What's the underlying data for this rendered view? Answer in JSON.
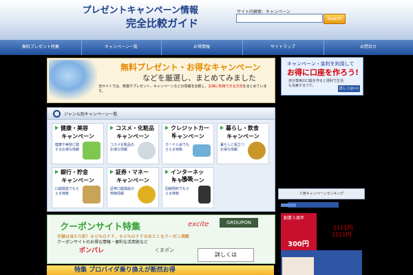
{
  "header": {
    "title_line1": "プレゼントキャンペーン情報",
    "title_line2": "完全比較ガイド",
    "search_label": "サイト内検索：キャンペーン",
    "search_placeholder": "",
    "search_button": "Search"
  },
  "nav": {
    "items": [
      {
        "label": "無料プレゼント特集"
      },
      {
        "label": "キャンペーン一覧"
      },
      {
        "label": "お得情報"
      },
      {
        "label": "サイトマップ"
      },
      {
        "label": "お問合せ"
      }
    ]
  },
  "banner": {
    "headline": "無料プレゼント・お得なキャンペーン",
    "subhead": "などを厳選し、まとめてみました",
    "body_prefix": "当サイトでは、懸賞やプレゼント、キャンペーンなどの情報を比較し、",
    "body_highlight": "お得に利用できる方法",
    "body_suffix": "をまとめています。"
  },
  "side_ad": {
    "line1": "キャンペーン・金利を利用して",
    "line2": "お得に口座を作ろう!",
    "line3": "自分専用の口座を作ると便利で生活も充実するワケ。",
    "button": "詳しくは>>"
  },
  "categories": {
    "heading": "ジャンル別キャンペーン一覧",
    "cards": [
      {
        "title": "健康・美容",
        "title2": "キャンペーン",
        "desc": "健康や美容に関するお得な情報",
        "color": "#7ec850"
      },
      {
        "title": "コスメ・化粧品",
        "title2": "キャンペーン",
        "desc": "コスメ化粧品のお得な情報",
        "color": "#d0d8e0"
      },
      {
        "title": "クレジットカード",
        "title2": "キャンペーン",
        "desc": "カード入会でもらえる特典",
        "color": "#6fb0d8"
      },
      {
        "title": "暮らし・飲食",
        "title2": "キャンペーン",
        "desc": "暮らしに役立つお得な情報",
        "color": "#c9962a"
      },
      {
        "title": "銀行・貯金",
        "title2": "キャンペーン",
        "desc": "口座開設でもらえる特典",
        "color": "#c9a357"
      },
      {
        "title": "証券・マネー",
        "title2": "キャンペーン",
        "desc": "証券口座開設の特典情報",
        "color": "#e0b020"
      },
      {
        "title": "インターネット・携帯",
        "title2": "キャンペーン",
        "desc": "回線契約でもらえる特典",
        "color": "#333333"
      }
    ]
  },
  "coupon": {
    "heading": "クーポンサイト特集",
    "excite": "excite",
    "groupon": "GROUPON",
    "line1": "半額は当たり前！８０％ＯＦＦ、９０％ＯＦＦのおとくなクーポン満載",
    "line2": "クーポンサイトのお得な情報・便利な活用術など",
    "logo1": "ポンパレ",
    "logo2": "くまポン",
    "button": "詳しくは"
  },
  "bottom_strip": "特集 プロバイダ乗り換えが断然お得",
  "ranking": {
    "heading": "人気キャンペーンランキング",
    "item1_tag": "創業３周年",
    "item1_price": "300円",
    "item1_nums": "1111円",
    "item1_nums2": "1111円"
  }
}
